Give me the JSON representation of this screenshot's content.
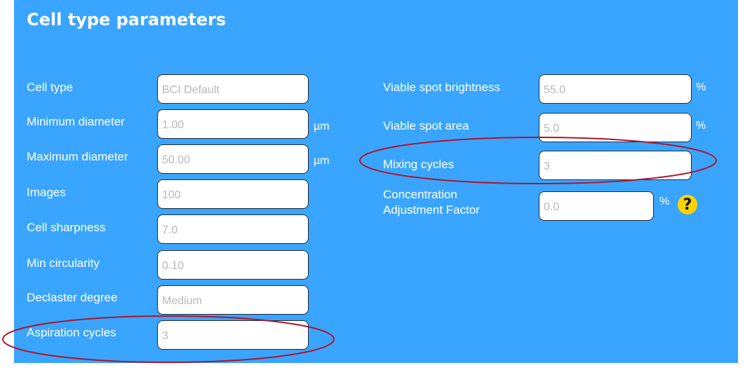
{
  "title": "Cell type parameters",
  "left": [
    {
      "label": "Cell type",
      "value": "BCI Default",
      "unit": ""
    },
    {
      "label": "Minimum diameter",
      "value": "1.00",
      "unit": "µm"
    },
    {
      "label": "Maximum diameter",
      "value": "50.00",
      "unit": "µm"
    },
    {
      "label": "Images",
      "value": "100",
      "unit": ""
    },
    {
      "label": "Cell sharpness",
      "value": "7.0",
      "unit": ""
    },
    {
      "label": "Min circularity",
      "value": "0.10",
      "unit": ""
    },
    {
      "label": "Declaster degree",
      "value": "Medium",
      "unit": ""
    },
    {
      "label": "Aspiration cycles",
      "value": "3",
      "unit": ""
    }
  ],
  "right": [
    {
      "label": "Viable spot brightness",
      "value": "55.0",
      "unit": "%"
    },
    {
      "label": "Viable spot area",
      "value": "5.0",
      "unit": "%"
    },
    {
      "label": "Mixing cycles",
      "value": "3",
      "unit": ""
    },
    {
      "label_line1": "Concentration",
      "label_line2": "Adjustment Factor",
      "value": "0.0",
      "unit": "%"
    }
  ],
  "help_icon_text": "?",
  "icons": {
    "help": "question-mark-icon"
  },
  "colors": {
    "panel": "#3aa5ff",
    "highlight_ellipse": "#b0142a",
    "help": "#ffd400"
  }
}
